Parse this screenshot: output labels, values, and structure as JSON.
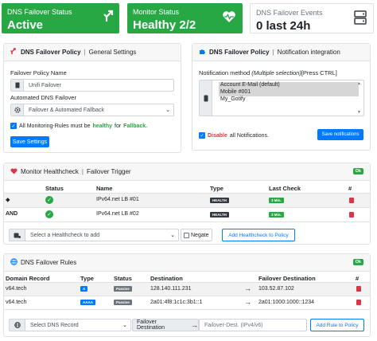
{
  "stats": {
    "status": {
      "label": "DNS Failover Status",
      "value": "Active"
    },
    "monitor": {
      "label": "Monitor Status",
      "value": "Healthy 2/2"
    },
    "events": {
      "label": "DNS Failover Events",
      "value": "0 last 24h"
    }
  },
  "policy_panel": {
    "title": "DNS Failover Policy",
    "subtitle": "General Settings",
    "name_label": "Failover Policy Name",
    "name_value": "Unifi Failover",
    "mode_label": "Automated DNS Failover",
    "mode_value": "Failover & Automated Fallback",
    "rule_text_pre": "All Monitoring-Rules must be",
    "rule_healthy": "healthy",
    "rule_text_mid": "for",
    "rule_fallback": "Fallback.",
    "save_label": "Save Settings"
  },
  "notify_panel": {
    "title": "DNS Failover Policy",
    "subtitle": "Notification integration",
    "method_label_pre": "Notification method ",
    "method_label_em": "(Multiple selection)",
    "method_label_post": "[Press CTRL]",
    "options": [
      "Account E-Mail (default)",
      "Mobile #001",
      "My_Gotify"
    ],
    "disable_word": "Disable",
    "disable_rest": "all Notifications.",
    "save_label": "Save notifications"
  },
  "healthcheck_panel": {
    "title": "Monitor Healthcheck",
    "subtitle": "Failover Trigger",
    "ok": "Ok",
    "columns": [
      "Status",
      "Name",
      "Type",
      "Last Check",
      "#"
    ],
    "rows": [
      {
        "prefix": "",
        "name": "IPv64.net LB #01",
        "type": "HEALTH",
        "last": "3 Min."
      },
      {
        "prefix": "AND",
        "name": "IPv64.net LB #02",
        "type": "HEALTH",
        "last": "3 Min."
      }
    ],
    "select_placeholder": "Select a Healthcheck to add",
    "negate_label": "Negate",
    "add_label": "Add Healthcheck to Policy"
  },
  "rules_panel": {
    "title": "DNS Failover Rules",
    "ok": "Ok",
    "columns": [
      "Domain Record",
      "Type",
      "Status",
      "Destination",
      "Failover Destination",
      "#"
    ],
    "rows": [
      {
        "domain": "v64.tech",
        "type": "A",
        "status": "Passive",
        "dest": "128.140.111.231",
        "failover": "103.52.87.102"
      },
      {
        "domain": "v64.tech",
        "type": "AAAA",
        "status": "Passive",
        "dest": "2a01:4f8:1c1c:3b1::1",
        "failover": "2a01:1000:1000::1234"
      }
    ],
    "select_placeholder": "Select DNS Record",
    "failover_dest_label": "Failover Destination",
    "failover_dest_placeholder": "Failover-Dest. (IPv4/v6)",
    "add_label": "Add Rule to Policy"
  },
  "colors": {
    "primary": "#007bff",
    "success": "#28a745",
    "danger": "#dc3545",
    "dark": "#343a40"
  }
}
